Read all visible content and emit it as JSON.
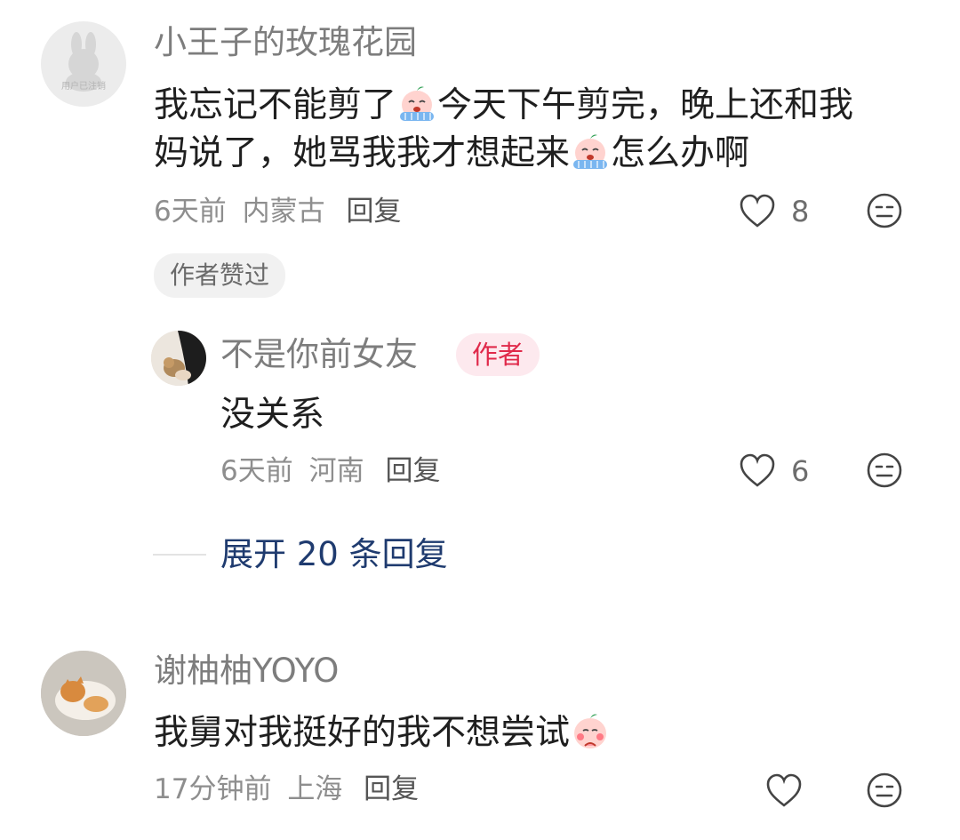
{
  "comments": [
    {
      "avatar": {
        "label": "用户已注销"
      },
      "username": "小王子的玫瑰花园",
      "text_parts": [
        "我忘记不能剪了",
        "今天下午剪完，晚上还和我",
        "妈说了，她骂我我才想起来",
        "怎么办啊"
      ],
      "emoji": "crying-emoji-icon",
      "time": "6天前",
      "location": "内蒙古",
      "reply_label": "回复",
      "likes": "8",
      "tag": "作者赞过",
      "replies": [
        {
          "username": "不是你前女友",
          "badge": "作者",
          "text": "没关系",
          "time": "6天前",
          "location": "河南",
          "reply_label": "回复",
          "likes": "6"
        }
      ],
      "expand_label": "展开 20 条回复"
    },
    {
      "username": "谢柚柚YOYO",
      "text": "我舅对我挺好的我不想尝试",
      "emoji": "shy-emoji-icon",
      "time": "17分钟前",
      "location": "上海",
      "reply_label": "回复",
      "likes": ""
    }
  ],
  "colors": {
    "author_badge": "#e0294a",
    "expand_link": "#1f3b6f"
  }
}
